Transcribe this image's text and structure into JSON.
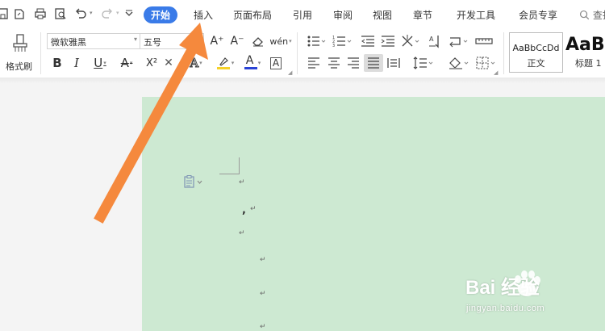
{
  "menu": {
    "tabs": [
      "开始",
      "插入",
      "页面布局",
      "引用",
      "审阅",
      "视图",
      "章节",
      "开发工具",
      "会员专享"
    ],
    "active_tab": "开始",
    "search_label": "查找"
  },
  "ribbon": {
    "format_painter_label": "格式刷",
    "font_name": "微软雅黑",
    "font_size": "五号",
    "bold": "B",
    "italic": "I",
    "underline": "U",
    "strikethrough": "A",
    "superscript": "X²",
    "font_color": "A",
    "char_border": "A",
    "grow_font": "A⁺",
    "shrink_font": "A⁻",
    "pinyin": "wén",
    "styles": [
      {
        "sample": "AaBbCcDd",
        "name": "正文"
      },
      {
        "sample": "AaBl",
        "name": "标题 1"
      }
    ]
  },
  "colors": {
    "accent": "#3a7be8",
    "page_bg": "#cde9d2",
    "arrow": "#f5893d",
    "highlight": "#f5d12a",
    "font_color": "#2a43d6"
  },
  "document": {
    "paragraph_mark": "↵",
    "comma_line": ",",
    "paste_icon": "paste-options-icon"
  },
  "watermark": {
    "brand": "Bai 经验",
    "url": "jingyan.baidu.com"
  }
}
